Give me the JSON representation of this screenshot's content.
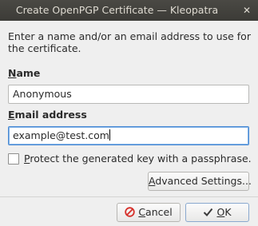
{
  "window": {
    "title": "Create OpenPGP Certificate — Kleopatra"
  },
  "intro_text": "Enter a name and/or an email address to use for the certificate.",
  "name": {
    "label_first": "N",
    "label_rest": "ame",
    "value": "Anonymous"
  },
  "email": {
    "label_first": "E",
    "label_rest": "mail address",
    "value": "example@test.com"
  },
  "passphrase": {
    "label_first": "P",
    "label_rest": "rotect the generated key with a passphrase.",
    "checked": false
  },
  "buttons": {
    "advanced_first": "A",
    "advanced_rest": "dvanced Settings...",
    "cancel_first": "C",
    "cancel_rest": "ancel",
    "ok_first": "O",
    "ok_rest": "K"
  },
  "icons": {
    "close": "close-icon",
    "cancel": "cancel-icon",
    "ok": "checkmark-icon"
  }
}
